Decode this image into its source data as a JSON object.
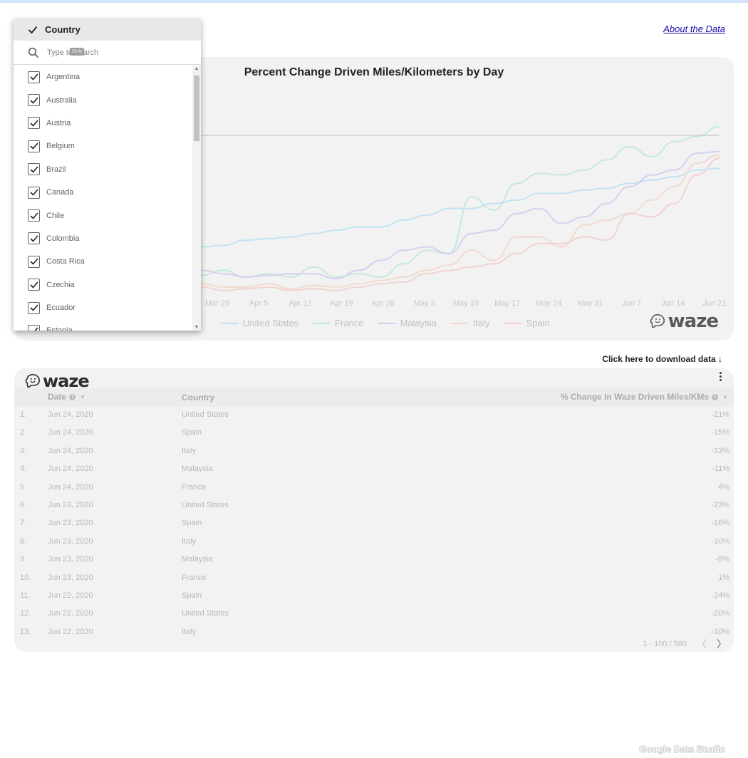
{
  "header": {
    "about_link": "About the Data"
  },
  "chart": {
    "title": "Percent Change Driven Miles/Kilometers by Day",
    "legend": [
      {
        "name": "United States",
        "color": "#4fc3f7"
      },
      {
        "name": "France",
        "color": "#5ed6a8"
      },
      {
        "name": "Malaysia",
        "color": "#a07cf0"
      },
      {
        "name": "Italy",
        "color": "#f4a582"
      },
      {
        "name": "Spain",
        "color": "#f28b82"
      }
    ],
    "brand": "waze"
  },
  "chart_data": {
    "type": "line",
    "title": "Percent Change Driven Miles/Kilometers by Day",
    "xlabel": "",
    "ylabel": "",
    "x_tick_labels": [
      "Mar 29",
      "Apr 5",
      "Apr 12",
      "Apr 19",
      "Apr 26",
      "May 3",
      "May 10",
      "May 17",
      "May 24",
      "May 31",
      "Jun 7",
      "Jun 14",
      "Jun 21"
    ],
    "ylim": [
      -95,
      20
    ],
    "grid": false,
    "legend_position": "bottom",
    "x": [
      "Mar 24",
      "Mar 28",
      "Apr 1",
      "Apr 5",
      "Apr 9",
      "Apr 13",
      "Apr 17",
      "Apr 21",
      "Apr 25",
      "Apr 29",
      "May 3",
      "May 7",
      "May 11",
      "May 15",
      "May 19",
      "May 23",
      "May 27",
      "May 31",
      "Jun 4",
      "Jun 8",
      "Jun 12",
      "Jun 16",
      "Jun 20",
      "Jun 24"
    ],
    "series": [
      {
        "name": "United States",
        "values": [
          -68,
          -67,
          -64,
          -63,
          -62,
          -60,
          -58,
          -56,
          -56,
          -52,
          -49,
          -45,
          -45,
          -42,
          -40,
          -36,
          -36,
          -34,
          -33,
          -30,
          -28,
          -26,
          -22,
          -21
        ]
      },
      {
        "name": "France",
        "values": [
          -85,
          -82,
          -86,
          -84,
          -86,
          -80,
          -86,
          -84,
          -86,
          -78,
          -70,
          -72,
          -38,
          -46,
          -30,
          -24,
          -25,
          -22,
          -16,
          -8,
          -14,
          -5,
          -2,
          4
        ]
      },
      {
        "name": "Malaysia",
        "values": [
          -82,
          -84,
          -86,
          -85,
          -84,
          -84,
          -87,
          -82,
          -76,
          -70,
          -68,
          -72,
          -60,
          -58,
          -48,
          -45,
          -54,
          -50,
          -42,
          -32,
          -25,
          -22,
          -12,
          -11
        ]
      },
      {
        "name": "Italy",
        "values": [
          -90,
          -92,
          -92,
          -90,
          -93,
          -91,
          -92,
          -90,
          -88,
          -86,
          -82,
          -79,
          -70,
          -76,
          -62,
          -62,
          -68,
          -55,
          -52,
          -48,
          -40,
          -32,
          -18,
          -13
        ]
      },
      {
        "name": "Spain",
        "values": [
          -92,
          -94,
          -93,
          -92,
          -94,
          -93,
          -94,
          -92,
          -90,
          -89,
          -84,
          -82,
          -80,
          -78,
          -72,
          -66,
          -66,
          -62,
          -64,
          -48,
          -50,
          -42,
          -25,
          -15
        ]
      }
    ]
  },
  "download": {
    "label": "Click here to download data ↓"
  },
  "table": {
    "brand": "waze",
    "columns": {
      "date": "Date",
      "country": "Country",
      "change": "% Change In Waze Driven Miles/KMs"
    },
    "rows": [
      {
        "idx": "1.",
        "date": "Jun 24, 2020",
        "country": "United States",
        "value": "-21%"
      },
      {
        "idx": "2.",
        "date": "Jun 24, 2020",
        "country": "Spain",
        "value": "-15%"
      },
      {
        "idx": "3.",
        "date": "Jun 24, 2020",
        "country": "Italy",
        "value": "-13%"
      },
      {
        "idx": "4.",
        "date": "Jun 24, 2020",
        "country": "Malaysia",
        "value": "-11%"
      },
      {
        "idx": "5.",
        "date": "Jun 24, 2020",
        "country": "France",
        "value": "4%"
      },
      {
        "idx": "6.",
        "date": "Jun 23, 2020",
        "country": "United States",
        "value": "-23%"
      },
      {
        "idx": "7.",
        "date": "Jun 23, 2020",
        "country": "Spain",
        "value": "-16%"
      },
      {
        "idx": "8.",
        "date": "Jun 23, 2020",
        "country": "Italy",
        "value": "-10%"
      },
      {
        "idx": "9.",
        "date": "Jun 23, 2020",
        "country": "Malaysia",
        "value": "-8%"
      },
      {
        "idx": "10.",
        "date": "Jun 23, 2020",
        "country": "France",
        "value": "1%"
      },
      {
        "idx": "11.",
        "date": "Jun 22, 2020",
        "country": "Spain",
        "value": "-24%"
      },
      {
        "idx": "12.",
        "date": "Jun 22, 2020",
        "country": "United States",
        "value": "-20%"
      },
      {
        "idx": "13.",
        "date": "Jun 22, 2020",
        "country": "Italy",
        "value": "-10%"
      }
    ],
    "pagination": "1 - 100 / 580"
  },
  "dropdown": {
    "header_label": "Country",
    "search_placeholder": "Type to search",
    "tooltip": "Only",
    "items": [
      "Argentina",
      "Australia",
      "Austria",
      "Belgium",
      "Brazil",
      "Canada",
      "Chile",
      "Colombia",
      "Costa Rica",
      "Czechia",
      "Ecuador",
      "Estonia"
    ]
  },
  "footer": {
    "brand": "Google Data Studio"
  },
  "colors": {
    "card_bg": "#f2f2f2",
    "checkbox": "#5f6368",
    "link": "#1a0dab"
  },
  "icons": {
    "check": "check-icon",
    "search": "search-icon",
    "menu": "more-vert-icon",
    "info": "info-icon"
  }
}
